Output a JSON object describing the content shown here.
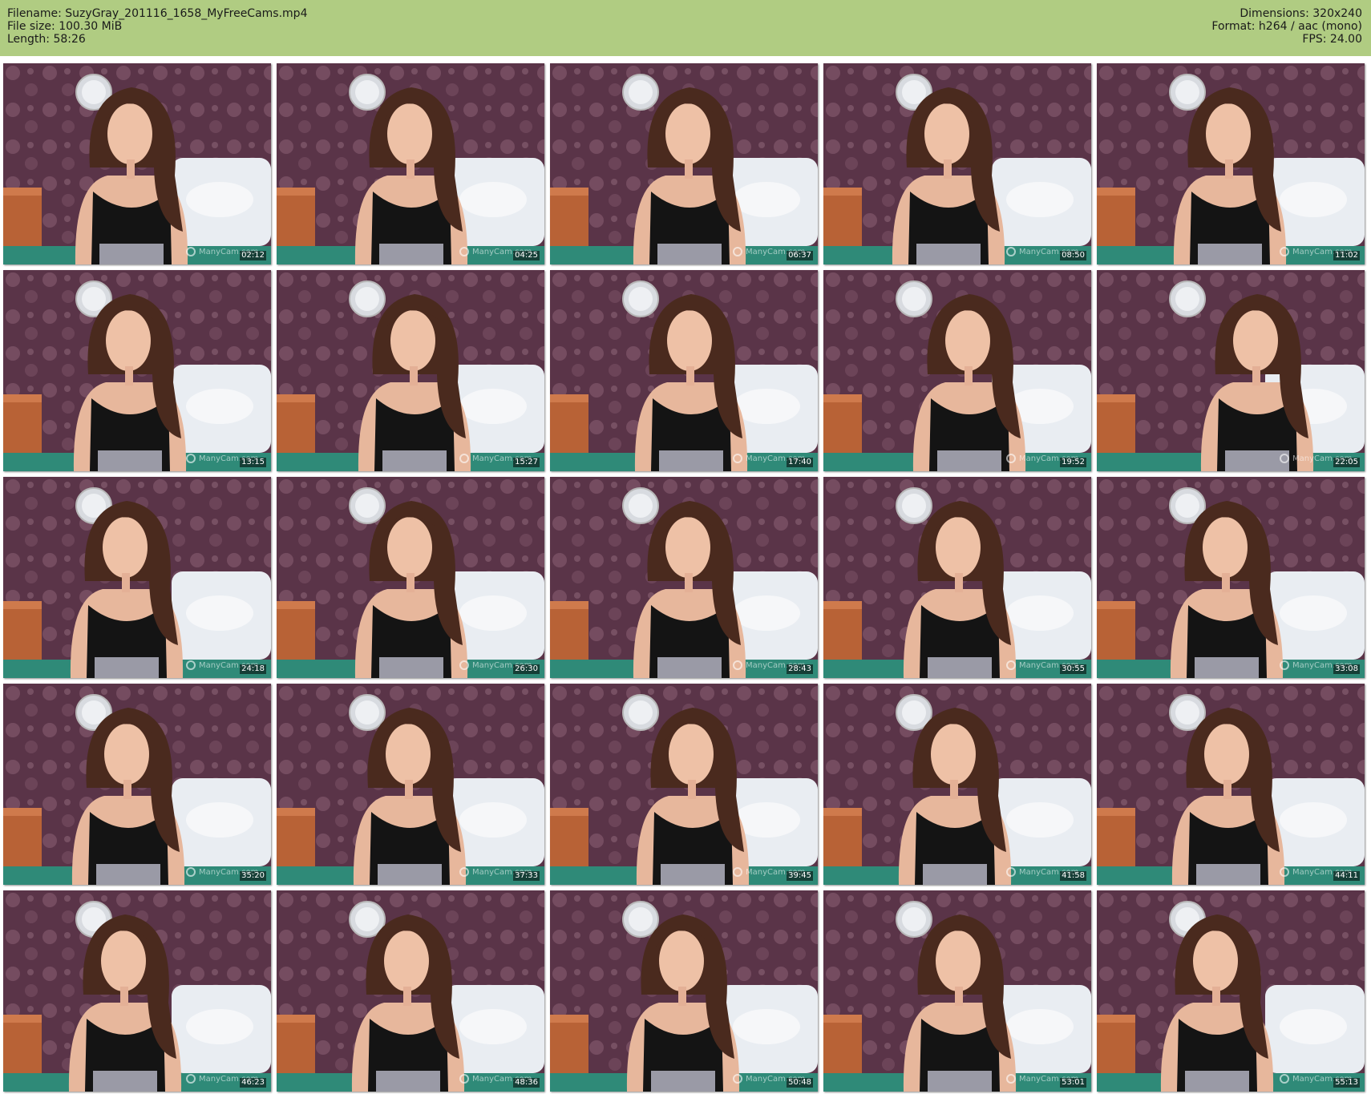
{
  "header": {
    "filename_line": "Filename: SuzyGray_201116_1658_MyFreeCams.mp4",
    "filesize_line": "File size: 100.30 MiB",
    "length_line": "Length: 58:26",
    "dimensions_line": "Dimensions: 320x240",
    "format_line": "Format: h264 / aac (mono)",
    "fps_line": "FPS: 24.00",
    "background_color": "#b0cc82"
  },
  "watermark_text": "ManyCam.com",
  "thumbnails": [
    {
      "timestamp": "02:12"
    },
    {
      "timestamp": "04:25"
    },
    {
      "timestamp": "06:37"
    },
    {
      "timestamp": "08:50"
    },
    {
      "timestamp": "11:02"
    },
    {
      "timestamp": "13:15"
    },
    {
      "timestamp": "15:27"
    },
    {
      "timestamp": "17:40"
    },
    {
      "timestamp": "19:52"
    },
    {
      "timestamp": "22:05"
    },
    {
      "timestamp": "24:18"
    },
    {
      "timestamp": "26:30"
    },
    {
      "timestamp": "28:43"
    },
    {
      "timestamp": "30:55"
    },
    {
      "timestamp": "33:08"
    },
    {
      "timestamp": "35:20"
    },
    {
      "timestamp": "37:33"
    },
    {
      "timestamp": "39:45"
    },
    {
      "timestamp": "41:58"
    },
    {
      "timestamp": "44:11"
    },
    {
      "timestamp": "46:23"
    },
    {
      "timestamp": "48:36"
    },
    {
      "timestamp": "50:48"
    },
    {
      "timestamp": "53:01"
    },
    {
      "timestamp": "55:13"
    }
  ]
}
